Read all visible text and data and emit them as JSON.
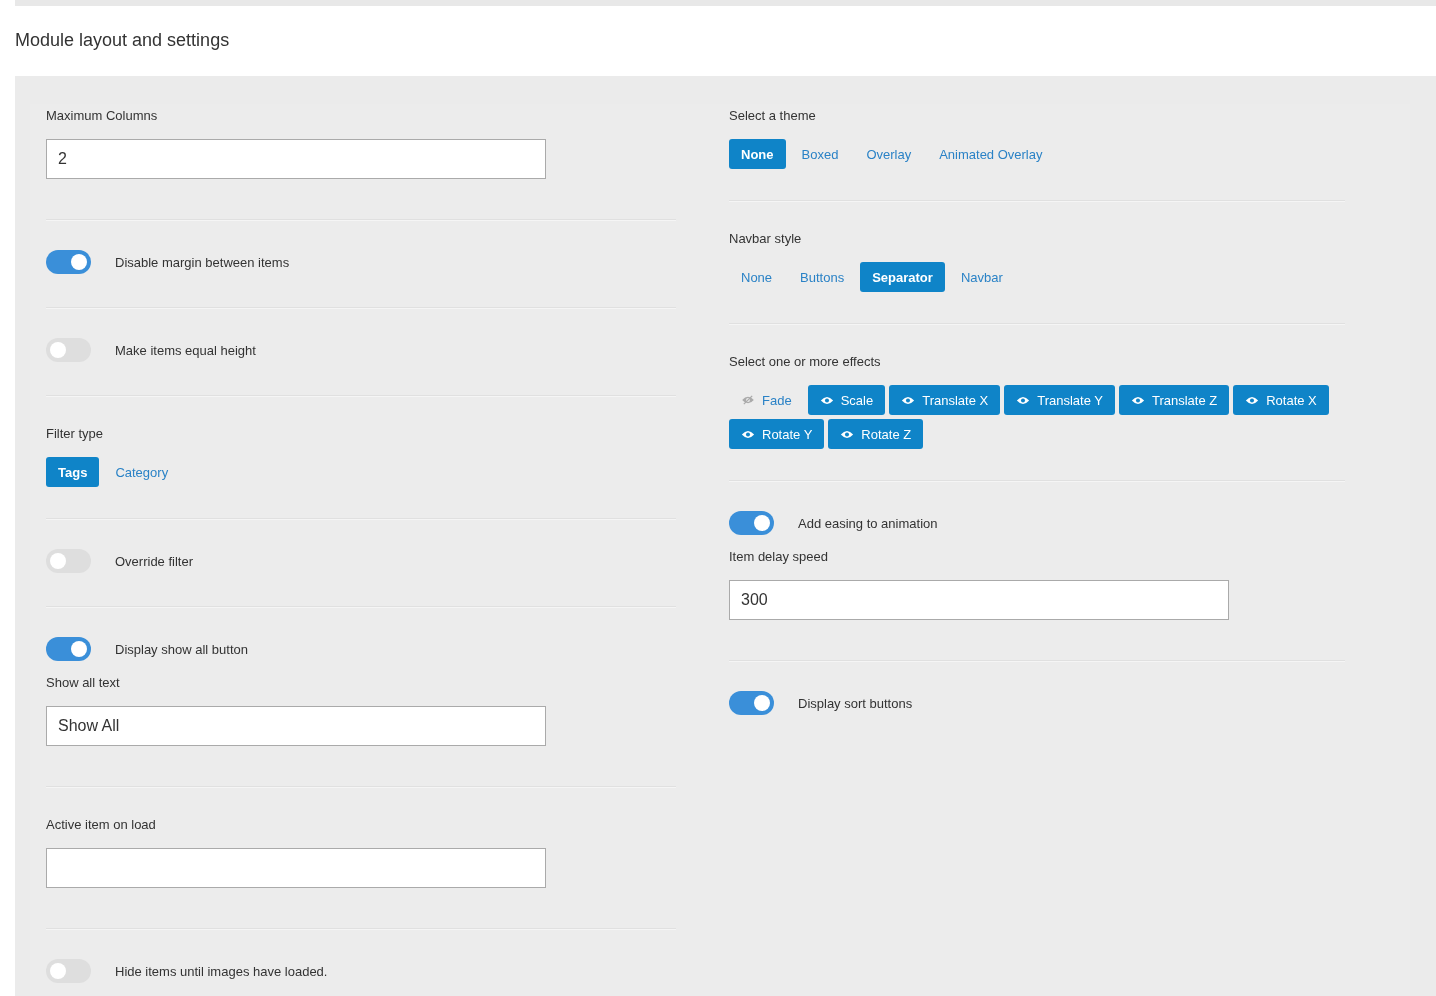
{
  "title": "Module layout and settings",
  "left": [
    {
      "items": [
        {
          "kind": "input",
          "label": "Maximum Columns",
          "value": "2"
        }
      ]
    },
    {
      "items": [
        {
          "kind": "toggle",
          "label": "Disable margin between items",
          "on": true
        }
      ]
    },
    {
      "items": [
        {
          "kind": "toggle",
          "label": "Make items equal height",
          "on": false
        }
      ]
    },
    {
      "items": [
        {
          "kind": "options",
          "label": "Filter type",
          "options": [
            {
              "label": "Tags",
              "selected": true
            },
            {
              "label": "Category",
              "selected": false
            }
          ]
        }
      ]
    },
    {
      "items": [
        {
          "kind": "toggle",
          "label": "Override filter",
          "on": false
        }
      ]
    },
    {
      "items": [
        {
          "kind": "toggle",
          "label": "Display show all button",
          "on": true
        },
        {
          "kind": "input",
          "label": "Show all text",
          "value": "Show All"
        }
      ]
    },
    {
      "items": [
        {
          "kind": "input",
          "label": "Active item on load"
        }
      ]
    },
    {
      "items": [
        {
          "kind": "toggle",
          "label": "Hide items until images have loaded.",
          "on": false
        }
      ]
    }
  ],
  "right": [
    {
      "items": [
        {
          "kind": "options",
          "label": "Select a theme",
          "options": [
            {
              "label": "None",
              "selected": true
            },
            {
              "label": "Boxed",
              "selected": false
            },
            {
              "label": "Overlay",
              "selected": false
            },
            {
              "label": "Animated Overlay",
              "selected": false
            }
          ]
        }
      ]
    },
    {
      "items": [
        {
          "kind": "options",
          "label": "Navbar style",
          "options": [
            {
              "label": "None",
              "selected": false
            },
            {
              "label": "Buttons",
              "selected": false
            },
            {
              "label": "Separator",
              "selected": true
            },
            {
              "label": "Navbar",
              "selected": false
            }
          ]
        }
      ]
    },
    {
      "items": [
        {
          "kind": "effects",
          "label": "Select one or more effects",
          "options": [
            {
              "label": "Fade",
              "selected": false
            },
            {
              "label": "Scale",
              "selected": true
            },
            {
              "label": "Translate X",
              "selected": true
            },
            {
              "label": "Translate Y",
              "selected": true
            },
            {
              "label": "Translate Z",
              "selected": true
            },
            {
              "label": "Rotate X",
              "selected": true
            },
            {
              "label": "Rotate Y",
              "selected": true
            },
            {
              "label": "Rotate Z",
              "selected": true
            }
          ]
        }
      ]
    },
    {
      "items": [
        {
          "kind": "toggle",
          "label": "Add easing to animation",
          "on": true
        },
        {
          "kind": "input",
          "label": "Item delay speed",
          "value": "300"
        }
      ]
    },
    {
      "items": [
        {
          "kind": "toggle",
          "label": "Display sort buttons",
          "on": true
        }
      ]
    }
  ]
}
